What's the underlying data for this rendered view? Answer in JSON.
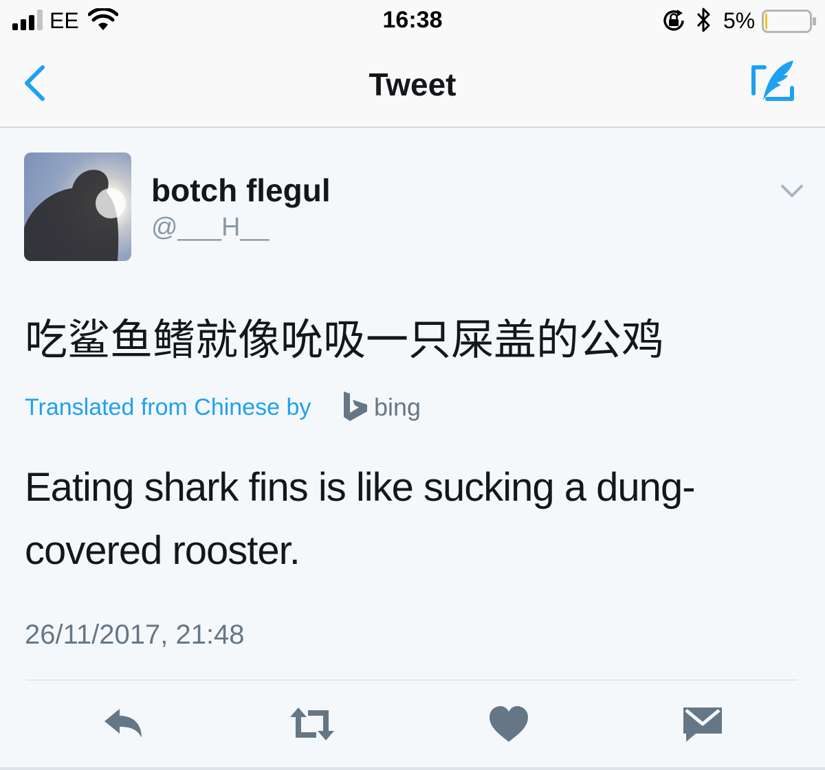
{
  "status_bar": {
    "carrier": "EE",
    "time": "16:38",
    "battery_percent": "5%",
    "battery_level": 0.05,
    "icons": [
      "signal-icon",
      "wifi-icon",
      "rotation-lock-icon",
      "bluetooth-icon",
      "battery-icon"
    ]
  },
  "nav": {
    "title": "Tweet",
    "icons": [
      "back-chevron-icon",
      "compose-tweet-icon"
    ]
  },
  "tweet": {
    "display_name": "botch flegul",
    "handle": "@___H__",
    "original_text": "吃鲨鱼鳍就像吮吸一只屎盖的公鸡",
    "translation_label": "Translated from Chinese by",
    "translation_provider": "bing",
    "translated_text": "Eating shark fins is like sucking a dung-covered rooster.",
    "timestamp": "26/11/2017, 21:48"
  },
  "actions": {
    "icons": [
      "reply-icon",
      "retweet-icon",
      "like-icon",
      "direct-message-icon"
    ]
  },
  "colors": {
    "accent": "#1da1f2",
    "secondary_text": "#657786",
    "action_icon": "#657786",
    "battery_low": "#f5c518"
  }
}
